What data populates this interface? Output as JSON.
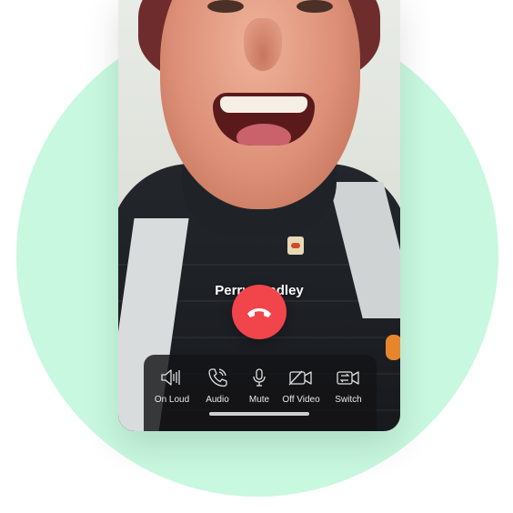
{
  "call": {
    "caller_name": "Perry Bradley"
  },
  "controls": [
    {
      "label": "On Loud",
      "icon": "speaker-icon"
    },
    {
      "label": "Audio",
      "icon": "phone-icon"
    },
    {
      "label": "Mute",
      "icon": "microphone-icon"
    },
    {
      "label": "Off Video",
      "icon": "video-off-icon"
    },
    {
      "label": "Switch",
      "icon": "camera-switch-icon"
    }
  ],
  "colors": {
    "background_circle": "#c8f8df",
    "end_call": "#f2454b",
    "controls_bar": "#141416"
  }
}
